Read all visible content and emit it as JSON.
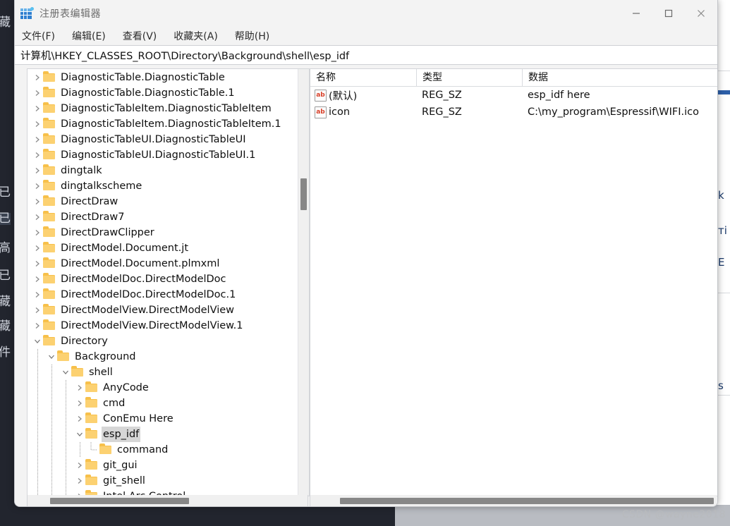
{
  "window": {
    "title": "注册表编辑器",
    "icon": "registry-editor-icon",
    "controls": {
      "minimize": "—",
      "maximize": "□",
      "close": "✕"
    }
  },
  "menu": [
    {
      "label": "文件(F)"
    },
    {
      "label": "编辑(E)"
    },
    {
      "label": "查看(V)"
    },
    {
      "label": "收藏夹(A)"
    },
    {
      "label": "帮助(H)"
    }
  ],
  "address": {
    "value": "计算机\\HKEY_CLASSES_ROOT\\Directory\\Background\\shell\\esp_idf"
  },
  "tree": {
    "items": [
      {
        "label": "DiagnosticTable.DiagnosticTable",
        "depth": 1,
        "state": "collapsed"
      },
      {
        "label": "DiagnosticTable.DiagnosticTable.1",
        "depth": 1,
        "state": "collapsed"
      },
      {
        "label": "DiagnosticTableItem.DiagnosticTableItem",
        "depth": 1,
        "state": "collapsed"
      },
      {
        "label": "DiagnosticTableItem.DiagnosticTableItem.1",
        "depth": 1,
        "state": "collapsed"
      },
      {
        "label": "DiagnosticTableUI.DiagnosticTableUI",
        "depth": 1,
        "state": "collapsed"
      },
      {
        "label": "DiagnosticTableUI.DiagnosticTableUI.1",
        "depth": 1,
        "state": "collapsed"
      },
      {
        "label": "dingtalk",
        "depth": 1,
        "state": "collapsed"
      },
      {
        "label": "dingtalkscheme",
        "depth": 1,
        "state": "collapsed"
      },
      {
        "label": "DirectDraw",
        "depth": 1,
        "state": "collapsed"
      },
      {
        "label": "DirectDraw7",
        "depth": 1,
        "state": "collapsed"
      },
      {
        "label": "DirectDrawClipper",
        "depth": 1,
        "state": "collapsed"
      },
      {
        "label": "DirectModel.Document.jt",
        "depth": 1,
        "state": "collapsed"
      },
      {
        "label": "DirectModel.Document.plmxml",
        "depth": 1,
        "state": "collapsed"
      },
      {
        "label": "DirectModelDoc.DirectModelDoc",
        "depth": 1,
        "state": "collapsed"
      },
      {
        "label": "DirectModelDoc.DirectModelDoc.1",
        "depth": 1,
        "state": "collapsed"
      },
      {
        "label": "DirectModelView.DirectModelView",
        "depth": 1,
        "state": "collapsed"
      },
      {
        "label": "DirectModelView.DirectModelView.1",
        "depth": 1,
        "state": "collapsed"
      },
      {
        "label": "Directory",
        "depth": 1,
        "state": "expanded"
      },
      {
        "label": "Background",
        "depth": 2,
        "state": "expanded"
      },
      {
        "label": "shell",
        "depth": 3,
        "state": "expanded"
      },
      {
        "label": "AnyCode",
        "depth": 4,
        "state": "collapsed"
      },
      {
        "label": "cmd",
        "depth": 4,
        "state": "collapsed"
      },
      {
        "label": "ConEmu Here",
        "depth": 4,
        "state": "collapsed"
      },
      {
        "label": "esp_idf",
        "depth": 4,
        "state": "expanded",
        "selected": true
      },
      {
        "label": "command",
        "depth": 5,
        "state": "leaf"
      },
      {
        "label": "git_gui",
        "depth": 4,
        "state": "collapsed"
      },
      {
        "label": "git_shell",
        "depth": 4,
        "state": "collapsed"
      },
      {
        "label": "Intel Arc Control",
        "depth": 4,
        "state": "collapsed"
      }
    ]
  },
  "values": {
    "columns": [
      {
        "label": "名称"
      },
      {
        "label": "类型"
      },
      {
        "label": "数据"
      }
    ],
    "rows": [
      {
        "icon": "string-value-icon",
        "name": "(默认)",
        "type": "REG_SZ",
        "data": "esp_idf here"
      },
      {
        "icon": "string-value-icon",
        "name": "icon",
        "type": "REG_SZ",
        "data": "C:\\my_program\\Espressif\\WIFI.ico"
      }
    ]
  },
  "watermark": {
    "text": "CSDN @wayne2018"
  },
  "background": {
    "left_chars": [
      "藏",
      "已",
      "已",
      "高",
      "已",
      "藏",
      "藏",
      "件"
    ],
    "right_texts": [
      "k",
      "ті",
      "E",
      "s"
    ]
  },
  "colors": {
    "folder": "#f7c04a",
    "selection": "#d6d6d6",
    "accent": "#2f7fd0",
    "string_icon_text": "#d8412a"
  }
}
